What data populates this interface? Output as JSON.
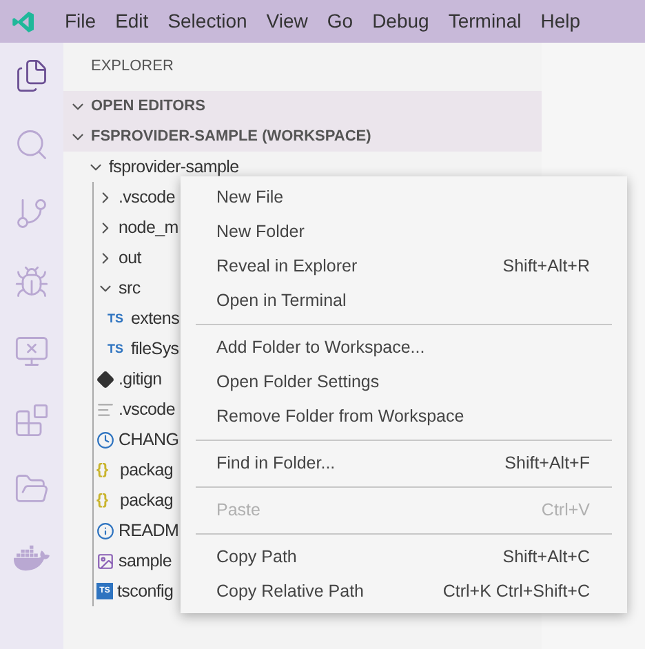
{
  "menubar": {
    "items": [
      "File",
      "Edit",
      "Selection",
      "View",
      "Go",
      "Debug",
      "Terminal",
      "Help"
    ]
  },
  "activity_bar": [
    {
      "kind": "files",
      "selected": true
    },
    {
      "kind": "search",
      "selected": false
    },
    {
      "kind": "git",
      "selected": false
    },
    {
      "kind": "debug",
      "selected": false
    },
    {
      "kind": "remote",
      "selected": false
    },
    {
      "kind": "extensions",
      "selected": false
    },
    {
      "kind": "folders",
      "selected": false
    },
    {
      "kind": "docker",
      "selected": false
    }
  ],
  "sidebar": {
    "title": "EXPLORER",
    "sections": [
      {
        "label": "OPEN EDITORS",
        "expanded": true
      },
      {
        "label": "FSPROVIDER-SAMPLE (WORKSPACE)",
        "expanded": true
      }
    ],
    "tree": [
      {
        "label": "fsprovider-sample",
        "kind": "folder",
        "expanded": true,
        "children": [
          {
            "label": ".vscode",
            "kind": "folder",
            "expanded": false
          },
          {
            "label": "node_m",
            "kind": "folder",
            "expanded": false
          },
          {
            "label": "out",
            "kind": "folder",
            "expanded": false
          },
          {
            "label": "src",
            "kind": "folder",
            "expanded": true,
            "children": [
              {
                "label": "extens",
                "kind": "ts",
                "badge": "TS"
              },
              {
                "label": "fileSys",
                "kind": "ts",
                "badge": "TS"
              }
            ]
          },
          {
            "label": ".gitign",
            "kind": "git"
          },
          {
            "label": ".vscode",
            "kind": "lines"
          },
          {
            "label": "CHANG",
            "kind": "history"
          },
          {
            "label": "packag",
            "kind": "json",
            "badge": "{}"
          },
          {
            "label": "packag",
            "kind": "json",
            "badge": "{}"
          },
          {
            "label": "READM",
            "kind": "info"
          },
          {
            "label": "sample",
            "kind": "image"
          },
          {
            "label": "tsconfig",
            "kind": "tsconfig",
            "badge": "TS"
          }
        ]
      }
    ]
  },
  "context_menu": [
    {
      "label": "New File",
      "disabled": false
    },
    {
      "label": "New Folder",
      "disabled": false
    },
    {
      "label": "Reveal in Explorer",
      "shortcut": "Shift+Alt+R",
      "disabled": false
    },
    {
      "label": "Open in Terminal",
      "disabled": false
    },
    {
      "kind": "separator"
    },
    {
      "label": "Add Folder to Workspace...",
      "disabled": false
    },
    {
      "label": "Open Folder Settings",
      "disabled": false
    },
    {
      "label": "Remove Folder from Workspace",
      "disabled": false
    },
    {
      "kind": "separator"
    },
    {
      "label": "Find in Folder...",
      "shortcut": "Shift+Alt+F",
      "disabled": false
    },
    {
      "kind": "separator"
    },
    {
      "label": "Paste",
      "shortcut": "Ctrl+V",
      "disabled": true
    },
    {
      "kind": "separator"
    },
    {
      "label": "Copy Path",
      "shortcut": "Shift+Alt+C",
      "disabled": false
    },
    {
      "label": "Copy Relative Path",
      "shortcut": "Ctrl+K Ctrl+Shift+C",
      "disabled": false
    }
  ]
}
